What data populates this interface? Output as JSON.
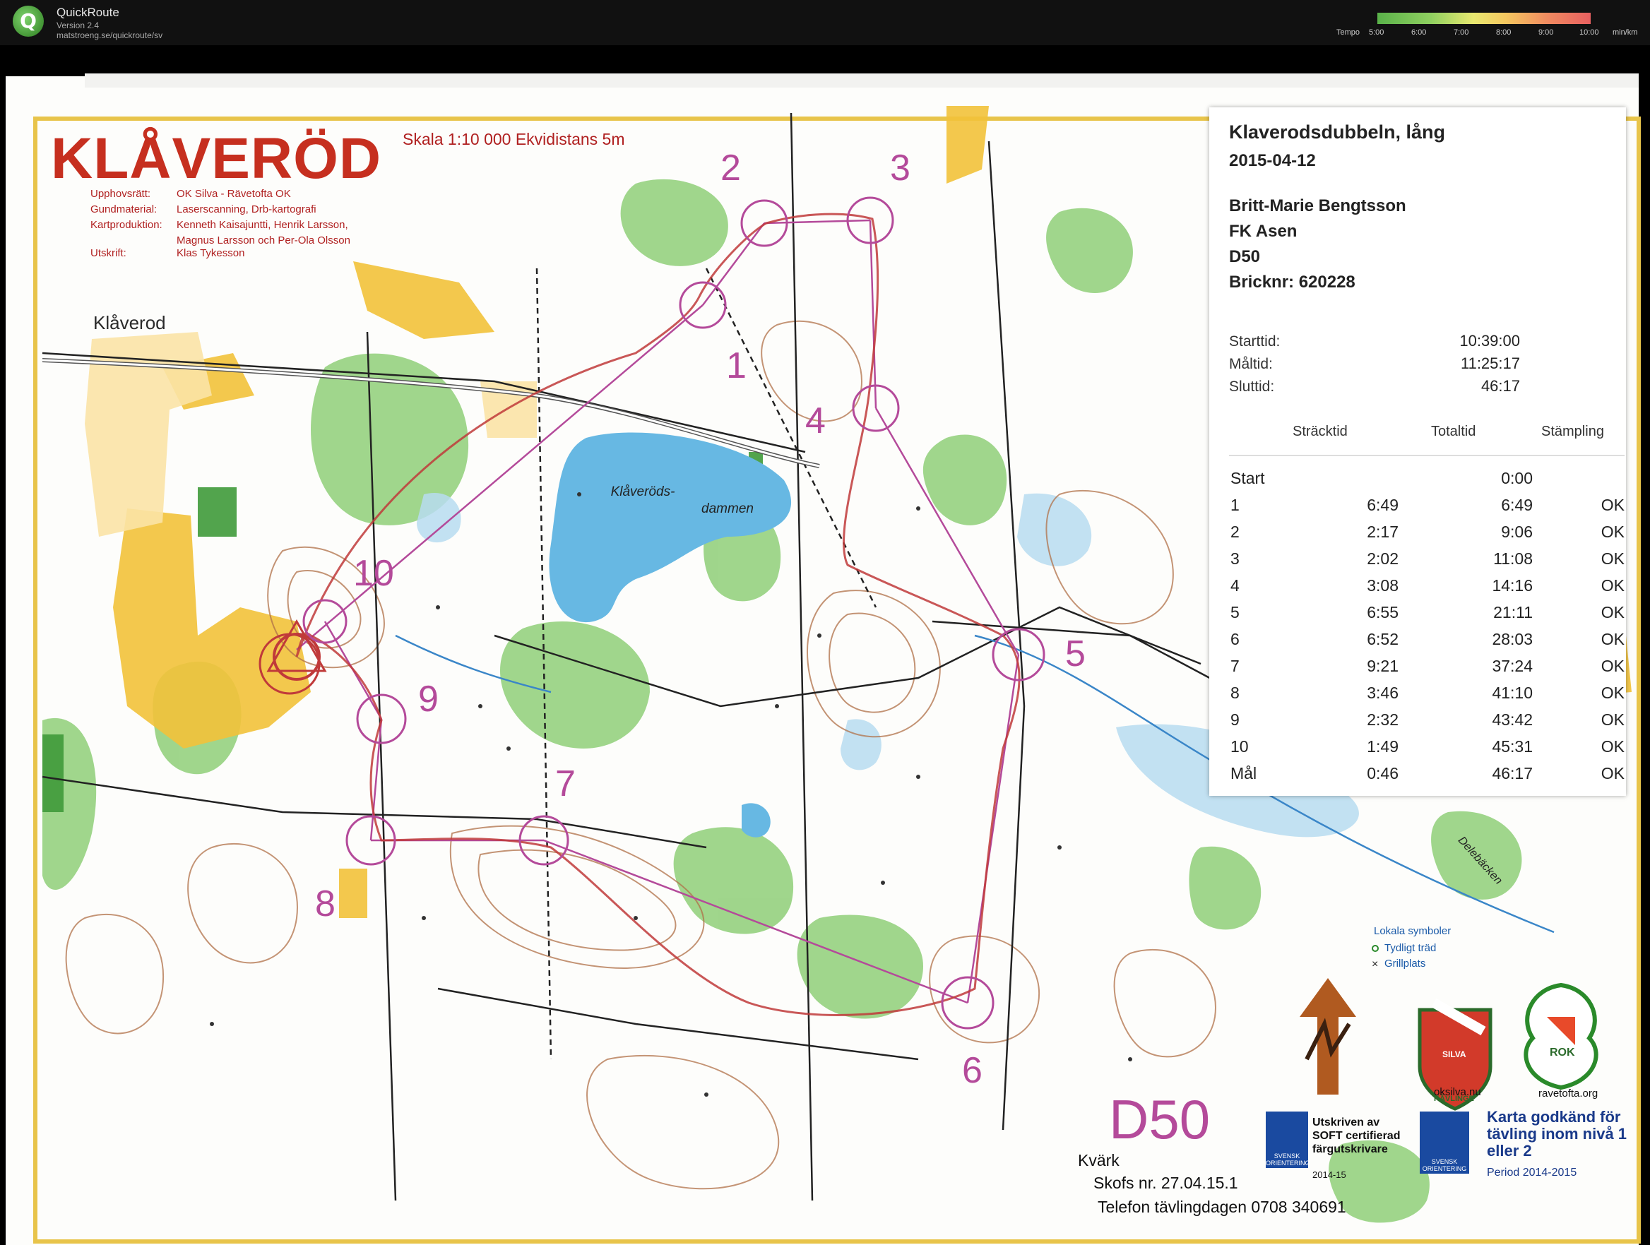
{
  "app": {
    "title": "QuickRoute",
    "version": "Version 2.4",
    "url": "matstroeng.se/quickroute/sv"
  },
  "tempo_legend": {
    "title": "Tempo",
    "ticks": [
      "5:00",
      "6:00",
      "7:00",
      "8:00",
      "9:00",
      "10:00"
    ],
    "unit": "min/km"
  },
  "map": {
    "title": "KLÅVERÖD",
    "scale": "Skala 1:10 000 Ekvidistans 5m",
    "credits": [
      {
        "label": "Upphovsrätt:",
        "value": "OK Silva - Rävetofta OK"
      },
      {
        "label": "Gundmaterial:",
        "value": "Laserscanning, Drb-kartografi"
      },
      {
        "label": "Kartproduktion:",
        "value": "Kenneth Kaisajuntti, Henrik Larsson,"
      },
      {
        "label": "",
        "value": "Magnus Larsson och Per-Ola Olsson"
      },
      {
        "label": "Utskrift:",
        "value": "Klas Tykesson"
      }
    ],
    "place_label": "Klåverod",
    "lake_label_1": "Klåveröds-",
    "lake_label_2": "dammen",
    "stream_label": "Delebäcken",
    "controls": [
      "1",
      "2",
      "3",
      "4",
      "5",
      "6",
      "7",
      "8",
      "9",
      "10"
    ],
    "class_label": "D50",
    "bottom": {
      "kvark": "Kvärk",
      "skofs": "Skofs nr. 27.04.15.1",
      "phone": "Telefon tävlingdagen 0708 340691"
    },
    "local_symbols": {
      "title": "Lokala symboler",
      "items": [
        "Tydligt träd",
        "Grillplats"
      ]
    },
    "logos": {
      "silva_label": "SILVA",
      "silva_sub": "KÅVLINGE",
      "rok_label": "ROK",
      "oksilva_url": "oksilva.nu",
      "ravetofta_url": "ravetofta.org",
      "svensk_badge": "SVENSK ORIENTERING"
    },
    "soft_notice": "Utskriven av SOFT certifierad färgutskrivare",
    "soft_year": "2014-15",
    "approved": "Karta godkänd för tävling inom nivå 1 eller 2",
    "approved_period": "Period 2014-2015"
  },
  "result_card": {
    "event": "Klaverodsdubbeln, lång",
    "date": "2015-04-12",
    "name": "Britt-Marie Bengtsson",
    "club": "FK Asen",
    "class": "D50",
    "chip": "Bricknr: 620228",
    "times": [
      {
        "label": "Starttid:",
        "value": "10:39:00"
      },
      {
        "label": "Måltid:",
        "value": "11:25:17"
      },
      {
        "label": "Sluttid:",
        "value": "46:17"
      }
    ],
    "headers": {
      "leg": "Sträcktid",
      "total": "Totaltid",
      "punch": "Stämpling"
    },
    "splits": [
      {
        "ctrl": "Start",
        "leg": "",
        "total": "0:00",
        "punch": ""
      },
      {
        "ctrl": "1",
        "leg": "6:49",
        "total": "6:49",
        "punch": "OK"
      },
      {
        "ctrl": "2",
        "leg": "2:17",
        "total": "9:06",
        "punch": "OK"
      },
      {
        "ctrl": "3",
        "leg": "2:02",
        "total": "11:08",
        "punch": "OK"
      },
      {
        "ctrl": "4",
        "leg": "3:08",
        "total": "14:16",
        "punch": "OK"
      },
      {
        "ctrl": "5",
        "leg": "6:55",
        "total": "21:11",
        "punch": "OK"
      },
      {
        "ctrl": "6",
        "leg": "6:52",
        "total": "28:03",
        "punch": "OK"
      },
      {
        "ctrl": "7",
        "leg": "9:21",
        "total": "37:24",
        "punch": "OK"
      },
      {
        "ctrl": "8",
        "leg": "3:46",
        "total": "41:10",
        "punch": "OK"
      },
      {
        "ctrl": "9",
        "leg": "2:32",
        "total": "43:42",
        "punch": "OK"
      },
      {
        "ctrl": "10",
        "leg": "1:49",
        "total": "45:31",
        "punch": "OK"
      },
      {
        "ctrl": "Mål",
        "leg": "0:46",
        "total": "46:17",
        "punch": "OK"
      }
    ]
  },
  "colors": {
    "course": "#b44a9a",
    "route": "#c03a3a",
    "forest_green": "#7cc46a",
    "open_yellow": "#f2c23a",
    "water_blue": "#67b8e3",
    "title_red": "#c62f1f"
  }
}
